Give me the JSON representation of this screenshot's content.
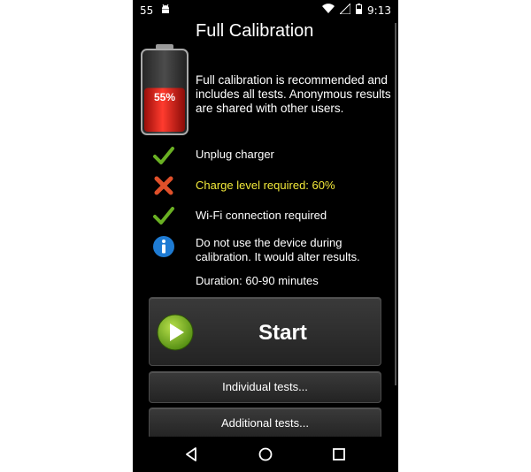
{
  "statusbar": {
    "notification_count": "55",
    "time": "9:13"
  },
  "header": {
    "title": "Full Calibration",
    "battery_percent": "55%",
    "battery_level": 0.55,
    "intro": "Full calibration is recommended and includes all tests. Anonymous results are shared with other users."
  },
  "requirements": [
    {
      "icon": "check-icon",
      "status": "ok",
      "text": "Unplug charger"
    },
    {
      "icon": "cross-icon",
      "status": "fail",
      "text": "Charge level required: 60%"
    },
    {
      "icon": "check-icon",
      "status": "ok",
      "text": "Wi-Fi connection required"
    },
    {
      "icon": "info-icon",
      "status": "info",
      "text": "Do not use the device during calibration. It would alter results."
    }
  ],
  "duration": "Duration: 60-90 minutes",
  "buttons": {
    "start": "Start",
    "individual": "Individual tests...",
    "additional": "Additional tests..."
  },
  "colors": {
    "ok": "#6ab023",
    "fail": "#e0502a",
    "info": "#1e7bd3",
    "warn_text": "#f2e93a",
    "battery_fill": "#e0201a"
  }
}
